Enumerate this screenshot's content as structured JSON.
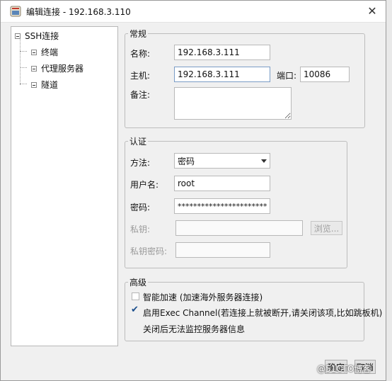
{
  "window": {
    "title": "编辑连接 - 192.168.3.110",
    "close_glyph": "✕"
  },
  "tree": {
    "root": "SSH连接",
    "children": [
      "终端",
      "代理服务器",
      "隧道"
    ]
  },
  "general": {
    "legend": "常规",
    "name_label": "名称:",
    "name_value": "192.168.3.111",
    "host_label": "主机:",
    "host_value": "192.168.3.111",
    "port_label": "端口:",
    "port_value": "10086",
    "note_label": "备注:"
  },
  "auth": {
    "legend": "认证",
    "method_label": "方法:",
    "method_value": "密码",
    "user_label": "用户名:",
    "user_value": "root",
    "password_label": "密码:",
    "password_value": "************************",
    "key_label": "私钥:",
    "browse_label": "浏览...",
    "key_password_label": "私钥密码:"
  },
  "advanced": {
    "legend": "高级",
    "smart_accel_label": "智能加速 (加速海外服务器连接)",
    "smart_accel_checked": false,
    "exec_channel_label": "启用Exec Channel(若连接上就被断开,请关闭该项,比如跳板机)",
    "exec_channel_checked": true,
    "exec_channel_note": "关闭后无法监控服务器信息"
  },
  "footer": {
    "ok_label": "确定",
    "cancel_label": "取消"
  },
  "watermark": "@51CTO博客"
}
